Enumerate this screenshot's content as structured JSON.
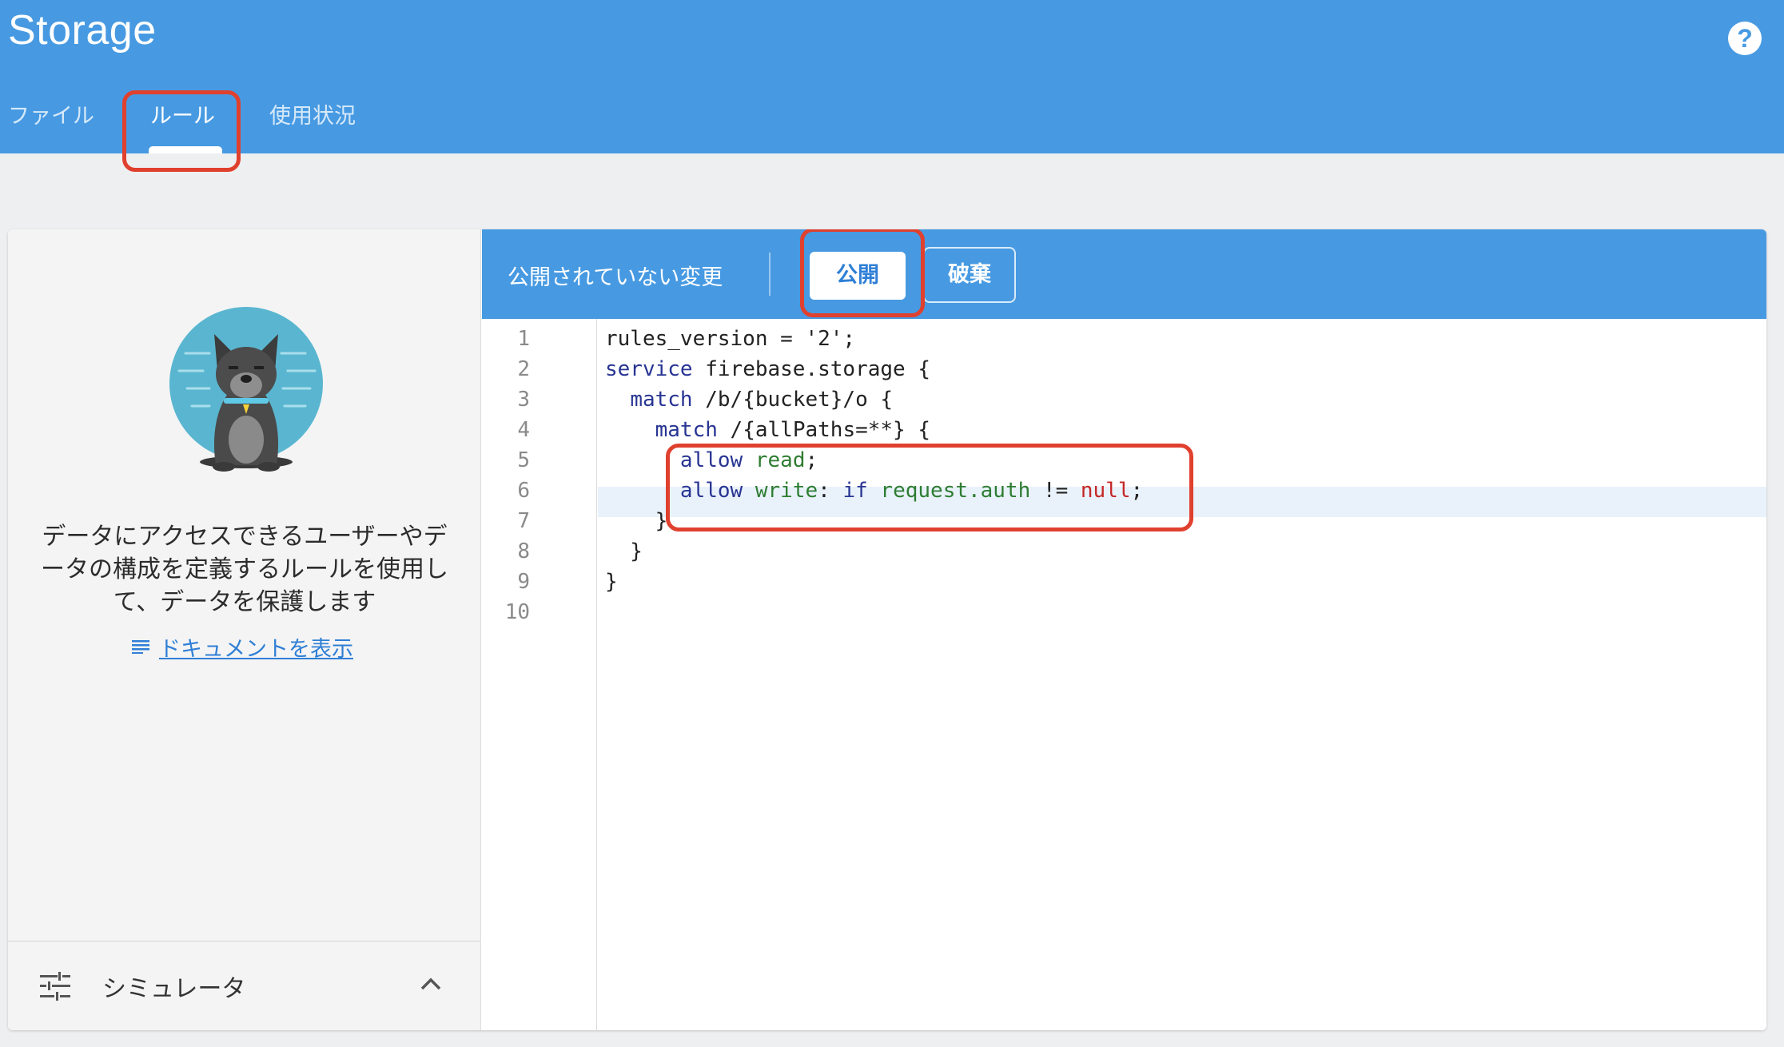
{
  "header": {
    "title": "Storage",
    "help_icon": "help-circle-icon",
    "tabs": [
      {
        "label": "ファイル",
        "active": false
      },
      {
        "label": "ルール",
        "active": true
      },
      {
        "label": "使用状況",
        "active": false
      }
    ]
  },
  "left_panel": {
    "description": "データにアクセスできるユーザーやデータの構成を定義するルールを使用して、データを保護します",
    "doc_link": "ドキュメントを表示",
    "doc_link_icon": "notes-icon",
    "simulator_label": "シミュレータ",
    "simulator_icon": "tune-sliders-icon",
    "simulator_chevron": "chevron-up-icon"
  },
  "toolbar": {
    "status": "公開されていない変更",
    "publish_label": "公開",
    "discard_label": "破棄"
  },
  "editor": {
    "line_numbers": [
      "1",
      "2",
      "3",
      "4",
      "5",
      "6",
      "7",
      "8",
      "9",
      "10"
    ],
    "lines": [
      "rules_version = '2';",
      "service firebase.storage {",
      "  match /b/{bucket}/o {",
      "    match /{allPaths=**} {",
      "      allow read;",
      "      allow write: if request.auth != null;",
      "    }",
      "  }",
      "}",
      ""
    ]
  },
  "colors": {
    "header_blue": "#479ae2",
    "highlight_red": "#e0402e",
    "link_blue": "#2f7fd6"
  }
}
